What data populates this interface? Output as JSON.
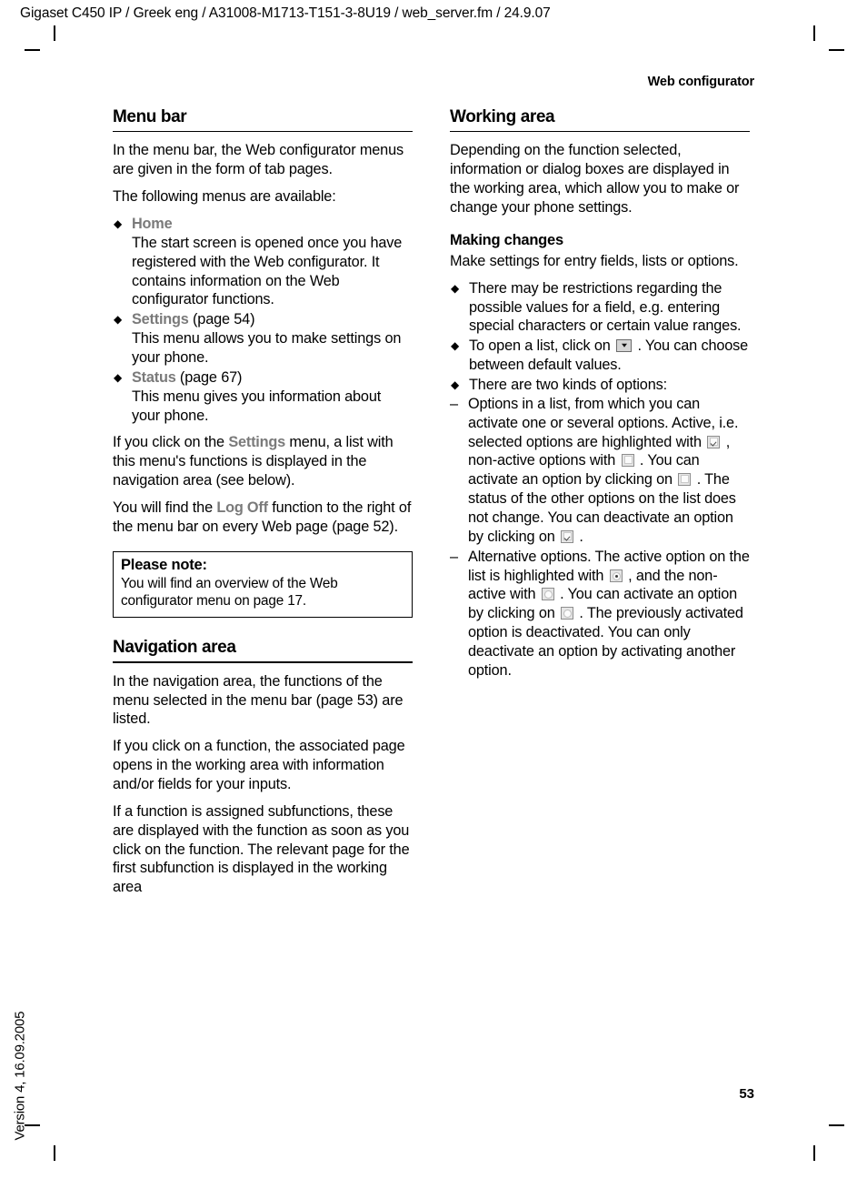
{
  "slug": "Gigaset C450 IP / Greek eng / A31008-M1713-T151-3-8U19 / web_server.fm / 24.9.07",
  "running_head": "Web configurator",
  "page_number": "53",
  "version_footer": "Version 4, 16.09.2005",
  "markers": {
    "bullet": "◆",
    "dash": "–"
  },
  "left_column": {
    "menu_bar": {
      "heading": "Menu bar",
      "intro": "In the menu bar, the Web configurator menus are given in the form of tab pages.",
      "lead": "The following menus are available:",
      "items": [
        {
          "term": "Home",
          "suffix": "",
          "description": "The start screen is opened once you have registered with the Web configurator. It contains information on the Web configurator functions."
        },
        {
          "term": "Settings",
          "suffix": " (page 54)",
          "description": "This menu allows you to make settings on your phone."
        },
        {
          "term": "Status",
          "suffix": " (page 67)",
          "description": "This menu gives you information about your phone."
        }
      ],
      "para_settings_a": "If you click on the ",
      "para_settings_term": "Settings",
      "para_settings_b": " menu, a list with this menu's functions is displayed in the navigation area (see below).",
      "para_logoff_a": "You will find the ",
      "para_logoff_term": "Log Off",
      "para_logoff_b": " function to the right of the menu bar on every Web page (page 52)."
    },
    "note": {
      "title": "Please note:",
      "text": "You will find an overview of the Web configurator menu on page 17."
    },
    "navigation_area": {
      "heading": "Navigation area",
      "paragraphs": [
        "In the navigation area, the functions of the menu selected in the menu bar (page 53) are listed.",
        "If you click on a function, the associated page opens in the working area with information and/or fields for your inputs.",
        "If a function is assigned subfunctions, these are displayed with the function as soon as you click on the function. The relevant page for the first subfunction is displayed in the working area"
      ]
    }
  },
  "right_column": {
    "working_area": {
      "heading": "Working area",
      "intro": "Depending on the function selected, information or dialog boxes are displayed in the working area, which allow you to make or change your phone settings."
    },
    "making_changes": {
      "heading": "Making changes",
      "intro": "Make settings for entry fields, lists or options.",
      "bullet_restrictions": "There may be restrictions regarding the possible values for a field, e.g. entering special characters or certain value ranges.",
      "bullet_open_list_a": "To open a list, click on",
      "bullet_open_list_b": ". You can choose between default values.",
      "bullet_two_kinds": "There are two kinds of options:",
      "option_list": {
        "seg_a": "Options in a list, from which you can activate one or several options. Active, i.e. selected options are highlighted with",
        "seg_b": ", non-active options with",
        "seg_c": ". You can activate an option by clicking on",
        "seg_d": ". The status of the other options on the list does not change. You can deactivate an option by clicking on",
        "seg_e": "."
      },
      "option_alternative": {
        "seg_a": "Alternative options. The active option on the list is highlighted with",
        "seg_b": ", and the non-active with",
        "seg_c": ". You can activate an option by clicking on",
        "seg_d": ". The previously activated option is deactivated. You can only deactivate an option by activating another option."
      }
    }
  },
  "icons": {
    "dropdown": "dropdown-arrow-icon",
    "checkbox_checked": "checkbox-checked-icon",
    "checkbox_unchecked": "checkbox-unchecked-icon",
    "radio_selected": "radio-selected-icon",
    "radio_unselected": "radio-unselected-icon"
  }
}
